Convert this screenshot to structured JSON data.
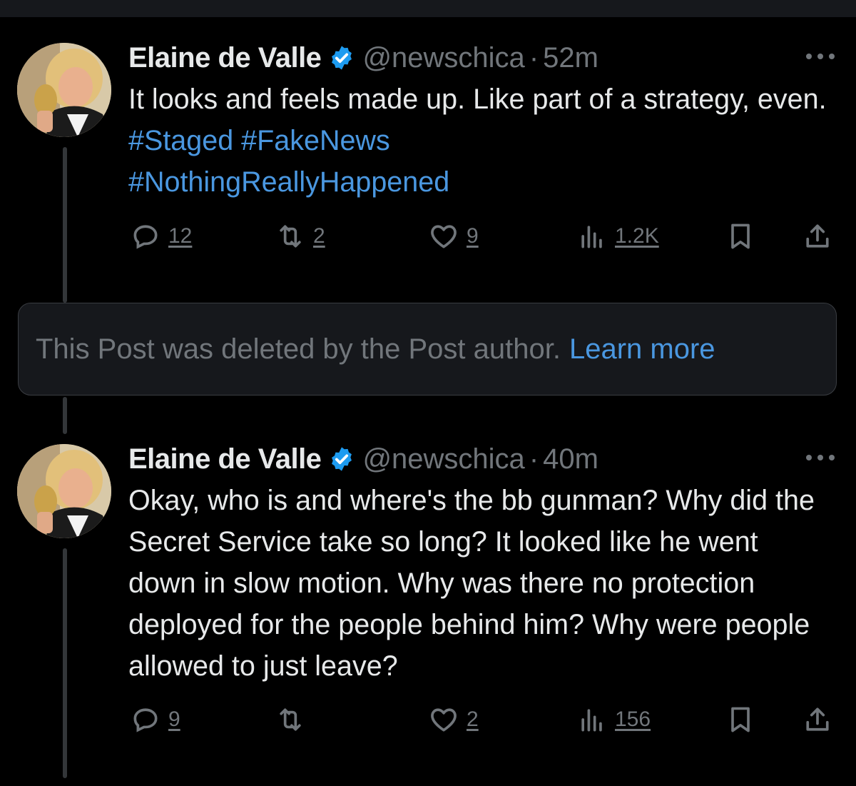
{
  "tweets": [
    {
      "author_name": "Elaine de Valle",
      "handle": "@newschica",
      "separator": "·",
      "time": "52m",
      "text_parts": [
        {
          "text": "It looks and feels made up. Like part of a strategy, even. ",
          "hashtag": false
        },
        {
          "text": "#Staged",
          "hashtag": true
        },
        {
          "text": " ",
          "hashtag": false
        },
        {
          "text": "#FakeNews",
          "hashtag": true
        },
        {
          "text": " ",
          "hashtag": false
        },
        {
          "text": "#NothingReallyHappened",
          "hashtag": true
        }
      ],
      "replies": "12",
      "reposts": "2",
      "likes": "9",
      "views": "1.2K"
    },
    {
      "author_name": "Elaine de Valle",
      "handle": "@newschica",
      "separator": "·",
      "time": "40m",
      "text_parts": [
        {
          "text": "Okay, who is and where's the bb gunman? Why did the Secret Service take so long? It looked like he went down in slow motion. Why was there no protection deployed for the people behind him? Why were people allowed to just leave?",
          "hashtag": false
        }
      ],
      "replies": "9",
      "reposts": "",
      "likes": "2",
      "views": "156"
    }
  ],
  "deleted_notice": {
    "text": "This Post was deleted by the Post author.",
    "link": "Learn more"
  },
  "icons": {
    "reply": "reply-icon",
    "repost": "repost-icon",
    "like": "heart-icon",
    "views": "views-icon",
    "bookmark": "bookmark-icon",
    "share": "share-icon",
    "verified": "verified-badge-icon",
    "more": "more-icon"
  },
  "colors": {
    "background": "#000000",
    "text": "#e7e9ea",
    "muted": "#71767b",
    "link": "#4a97e0",
    "verified": "#1d9bf0"
  }
}
